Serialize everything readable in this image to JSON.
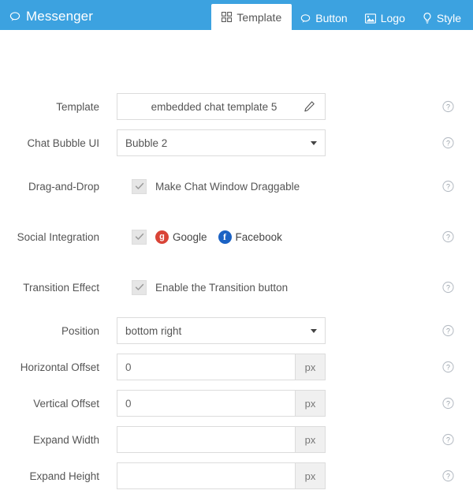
{
  "header": {
    "brand": {
      "icon": "chat-bubble-icon",
      "label": "Messenger"
    },
    "tabs": [
      {
        "id": "template",
        "label": "Template",
        "icon": "grid-icon",
        "active": true
      },
      {
        "id": "button",
        "label": "Button",
        "icon": "chat-bubble-icon",
        "active": false
      },
      {
        "id": "logo",
        "label": "Logo",
        "icon": "image-icon",
        "active": false
      },
      {
        "id": "style",
        "label": "Style",
        "icon": "lightbulb-icon",
        "active": false
      }
    ],
    "background_color": "#3ca2e0",
    "active_tab_color": "#ffffff"
  },
  "form": {
    "template": {
      "label": "Template",
      "value": "embedded chat template 5",
      "edit_icon": "pencil-icon"
    },
    "chat_bubble_ui": {
      "label": "Chat Bubble UI",
      "value": "Bubble 2"
    },
    "drag_and_drop": {
      "label": "Drag-and-Drop",
      "checkbox_label": "Make Chat Window Draggable",
      "checked": true
    },
    "social": {
      "label": "Social Integration",
      "checked": true,
      "providers": [
        {
          "name": "Google",
          "icon": "google-plus-icon",
          "color": "#d94437",
          "glyph": "g"
        },
        {
          "name": "Facebook",
          "icon": "facebook-icon",
          "color": "#1b62c4",
          "glyph": "f"
        }
      ]
    },
    "transition": {
      "label": "Transition Effect",
      "checkbox_label": "Enable the Transition button",
      "checked": true
    },
    "position": {
      "label": "Position",
      "value": "bottom right"
    },
    "horizontal_offset": {
      "label": "Horizontal Offset",
      "value": "0",
      "placeholder": "",
      "unit": "px"
    },
    "vertical_offset": {
      "label": "Vertical Offset",
      "value": "0",
      "placeholder": "",
      "unit": "px"
    },
    "expand_width": {
      "label": "Expand Width",
      "value": "",
      "placeholder": "",
      "unit": "px"
    },
    "expand_height": {
      "label": "Expand Height",
      "value": "",
      "placeholder": "",
      "unit": "px"
    },
    "help_icon": "help-circle-icon"
  }
}
